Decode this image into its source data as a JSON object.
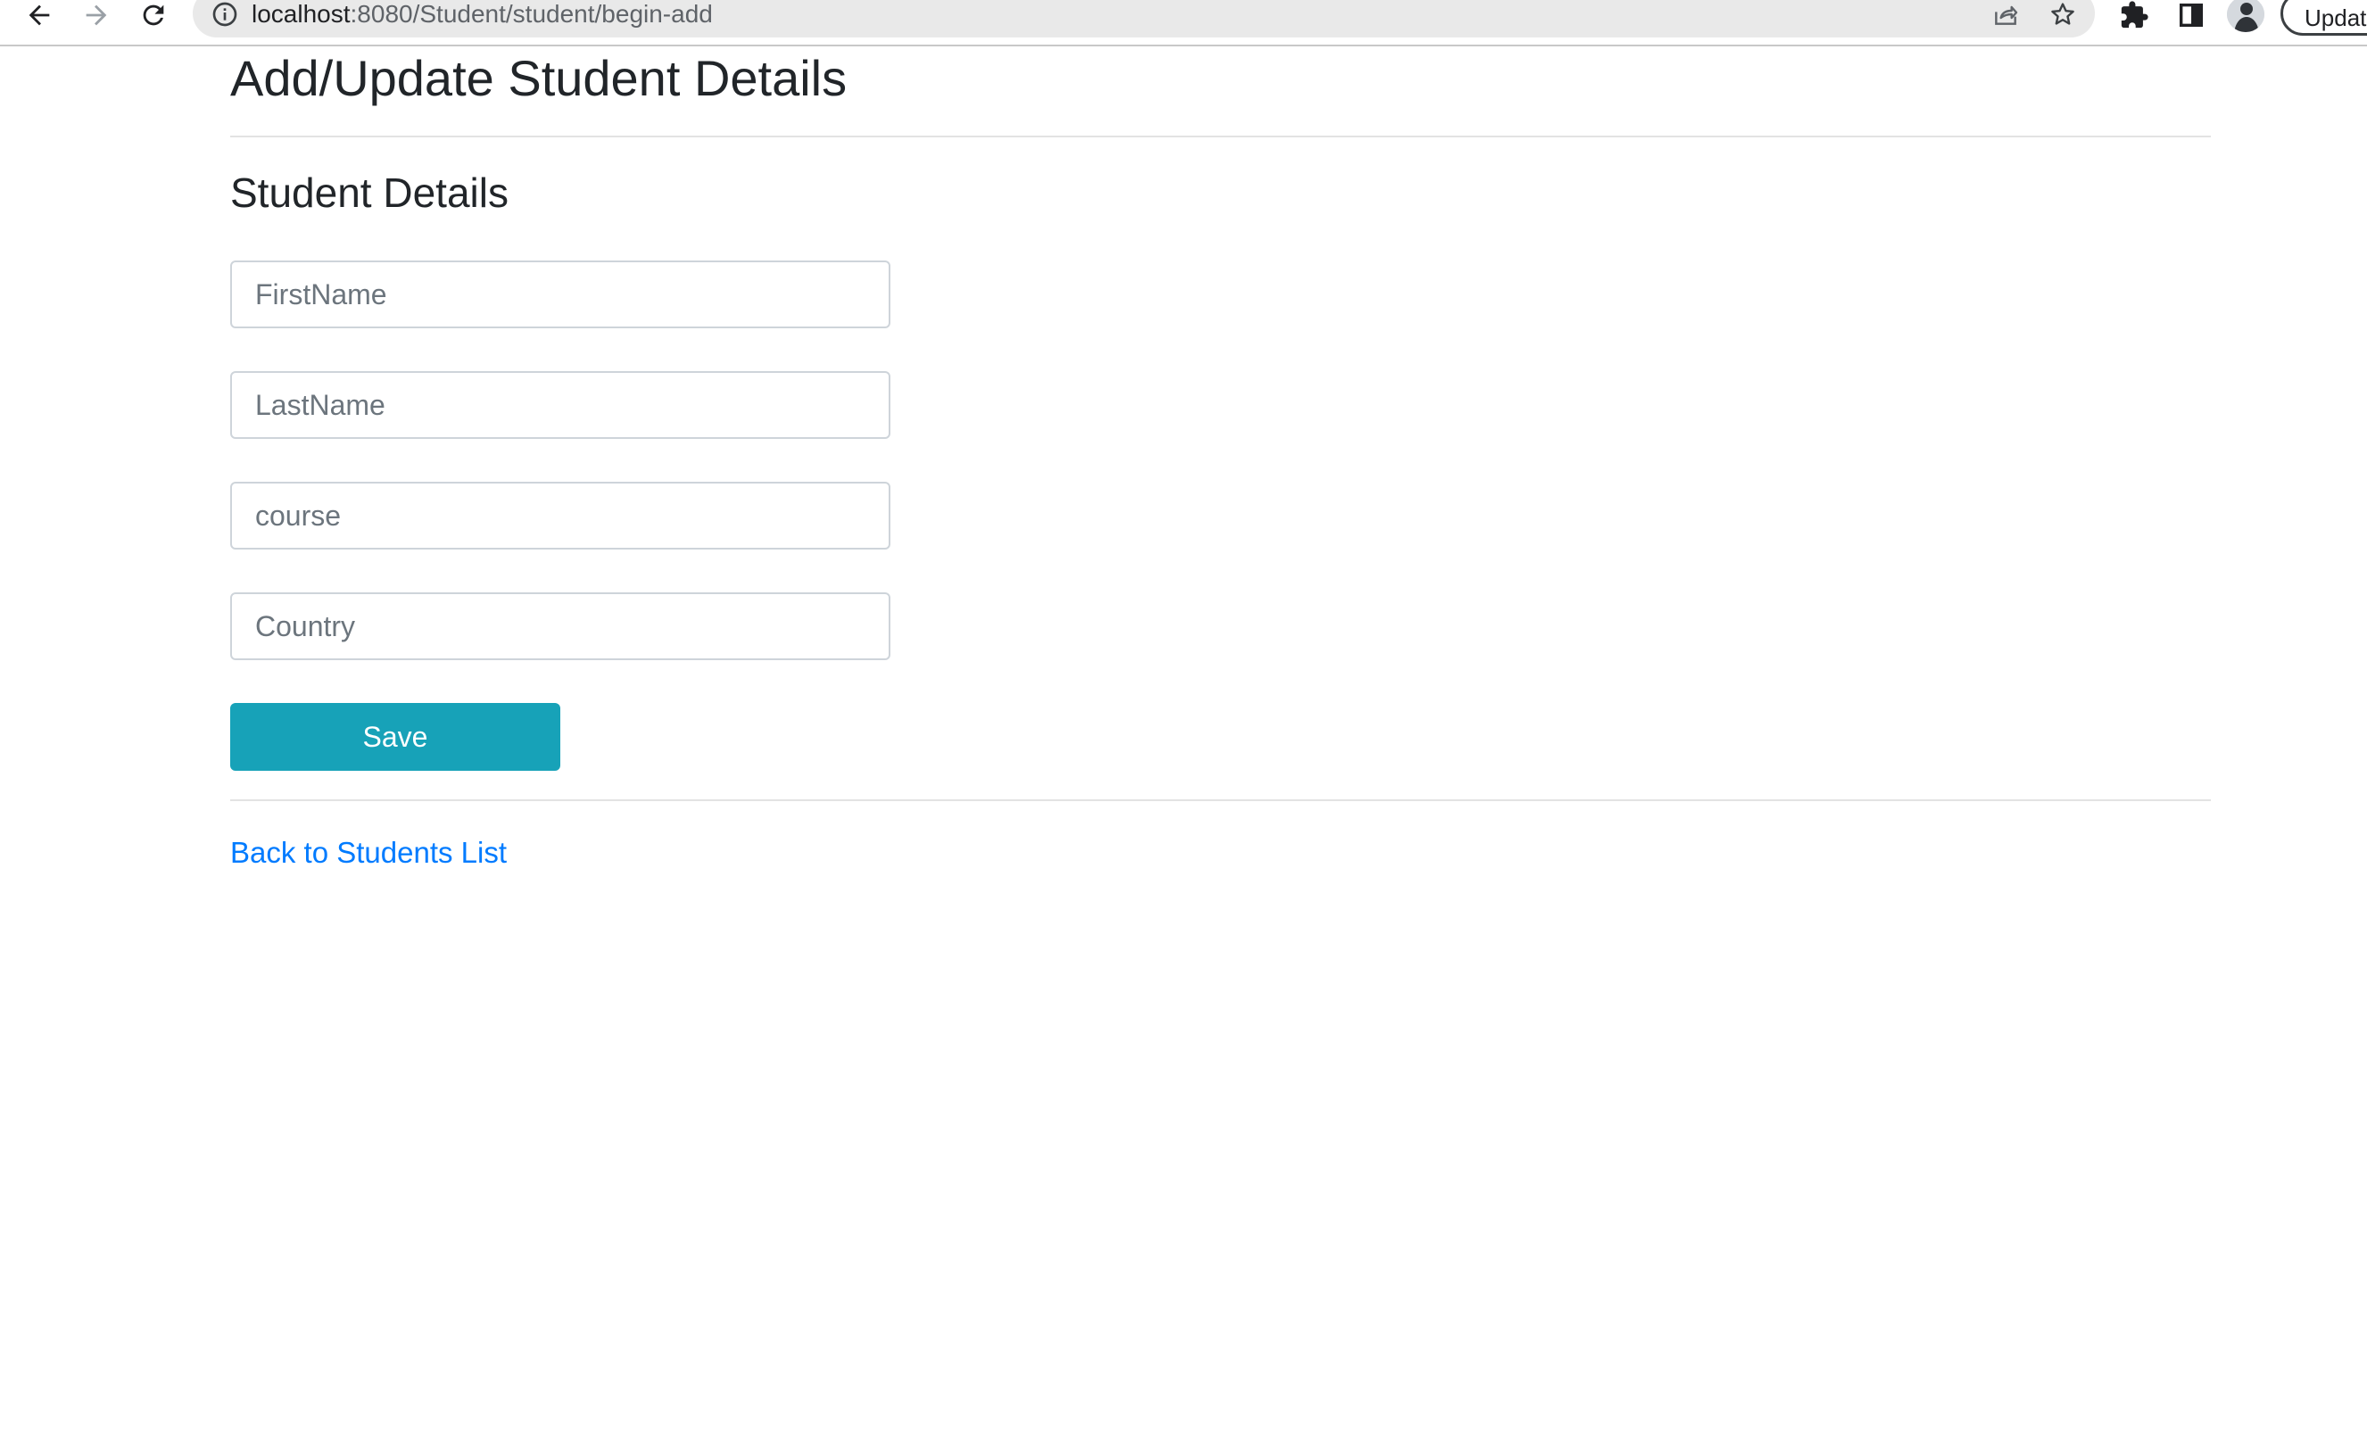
{
  "browser": {
    "url_host": "localhost",
    "url_path": ":8080/Student/student/begin-add",
    "update_label": "Update",
    "icons": {
      "back": "arrow-left-icon",
      "forward": "arrow-right-icon",
      "reload": "reload-icon",
      "site_info": "info-icon",
      "share": "share-icon",
      "bookmark": "star-icon",
      "extensions": "puzzle-icon",
      "side_panel": "side-panel-icon",
      "profile": "avatar"
    }
  },
  "page": {
    "title": "Add/Update Student Details",
    "section_title": "Student Details",
    "form": {
      "first_name": {
        "placeholder": "FirstName",
        "value": ""
      },
      "last_name": {
        "placeholder": "LastName",
        "value": ""
      },
      "course": {
        "placeholder": "course",
        "value": ""
      },
      "country": {
        "placeholder": "Country",
        "value": ""
      },
      "save_label": "Save"
    },
    "back_link": "Back to Students List"
  },
  "colors": {
    "save_button": "#17a2b8",
    "link": "#007bff",
    "text": "#212529",
    "input_border": "#ced4da"
  }
}
